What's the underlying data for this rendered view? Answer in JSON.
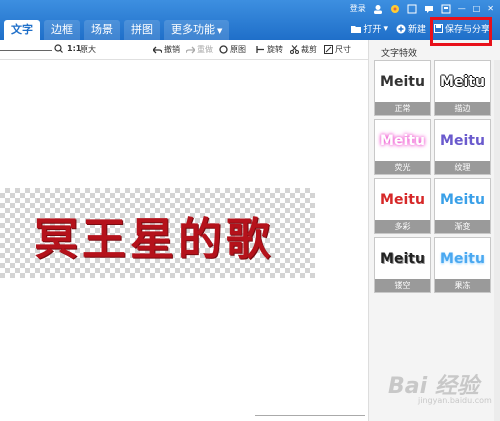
{
  "window": {
    "top_actions": {
      "login": "登录",
      "minimize": "—",
      "maximize": "□",
      "close": "✕"
    },
    "tabs": [
      {
        "label": "文字",
        "active": true
      },
      {
        "label": "边框",
        "active": false
      },
      {
        "label": "场景",
        "active": false
      },
      {
        "label": "拼图",
        "active": false
      },
      {
        "label": "更多功能",
        "active": false
      }
    ],
    "actions": {
      "open": "打开",
      "new": "新建",
      "save_share": "保存与分享"
    }
  },
  "toolbar": {
    "zoom_ratio": "1:1",
    "zoom_in": "原大",
    "undo": "撤销",
    "redo": "重做",
    "original": "原图",
    "rotate": "旋转",
    "crop": "裁剪",
    "size": "尺寸"
  },
  "canvas": {
    "text": "冥王星的歌"
  },
  "panel": {
    "title": "文字特效",
    "effects": [
      {
        "preview": "Meitu",
        "label": "正常",
        "color": "#333333"
      },
      {
        "preview": "Meitu",
        "label": "描边",
        "color": "#111111"
      },
      {
        "preview": "Meitu",
        "label": "荧光",
        "color": "#f4a6e8"
      },
      {
        "preview": "Meitu",
        "label": "纹理",
        "color": "#6a5acd"
      },
      {
        "preview": "Meitu",
        "label": "多彩",
        "color": "#d62828"
      },
      {
        "preview": "Meitu",
        "label": "渐变",
        "color": "#3aa0e8"
      },
      {
        "preview": "Meitu",
        "label": "镂空",
        "color": "#222222"
      },
      {
        "preview": "Meitu",
        "label": "果冻",
        "color": "#4aa8f0"
      }
    ]
  },
  "watermark": {
    "logo": "Bai 经验",
    "url": "jingyan.baidu.com"
  },
  "colors": {
    "accent": "#1f6fc9",
    "highlight_box": "#e8101a",
    "art_text": "#b5121b"
  }
}
